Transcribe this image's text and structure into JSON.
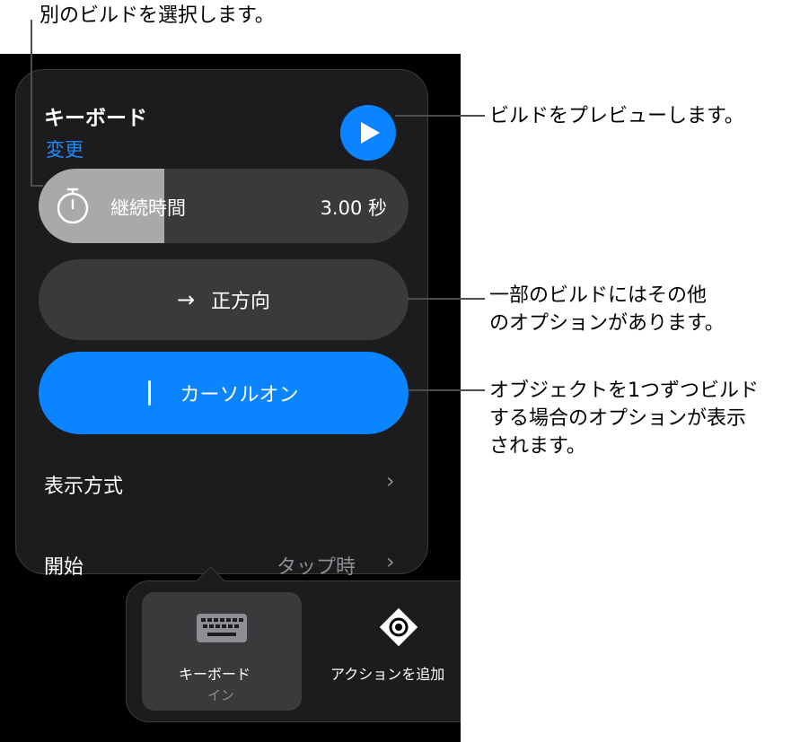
{
  "popover": {
    "title": "キーボード",
    "change_label": "変更",
    "duration_label": "継続時間",
    "duration_value": "3.00 秒",
    "duration_fraction": 0.34,
    "direction_label": "正方向",
    "cursor_label": "カーソルオン",
    "delivery_label": "表示方式",
    "start_label": "開始",
    "start_value": "タップ時"
  },
  "tray": {
    "selected_name": "キーボード",
    "selected_sub": "イン",
    "next_name": "アクションを追加"
  },
  "callouts": {
    "select_build": "別のビルドを選択します。",
    "preview": "ビルドをプレビューします。",
    "options_line1": "一部のビルドにはその他",
    "options_line2": "のオプションがあります。",
    "delivery_line1": "オブジェクトを1つずつビルド",
    "delivery_line2": "する場合のオプションが表示",
    "delivery_line3": "されます。"
  },
  "icons": {
    "play": "play-icon",
    "stopwatch": "stopwatch-icon",
    "arrow": "arrow-right-icon",
    "chevron": "chevron-right-icon",
    "keyboard": "keyboard-icon",
    "action": "action-diamond-icon"
  },
  "colors": {
    "accent": "#0a84ff",
    "link": "#1a8cff",
    "panel": "#1c1c1e",
    "button": "#3a3a3c"
  }
}
